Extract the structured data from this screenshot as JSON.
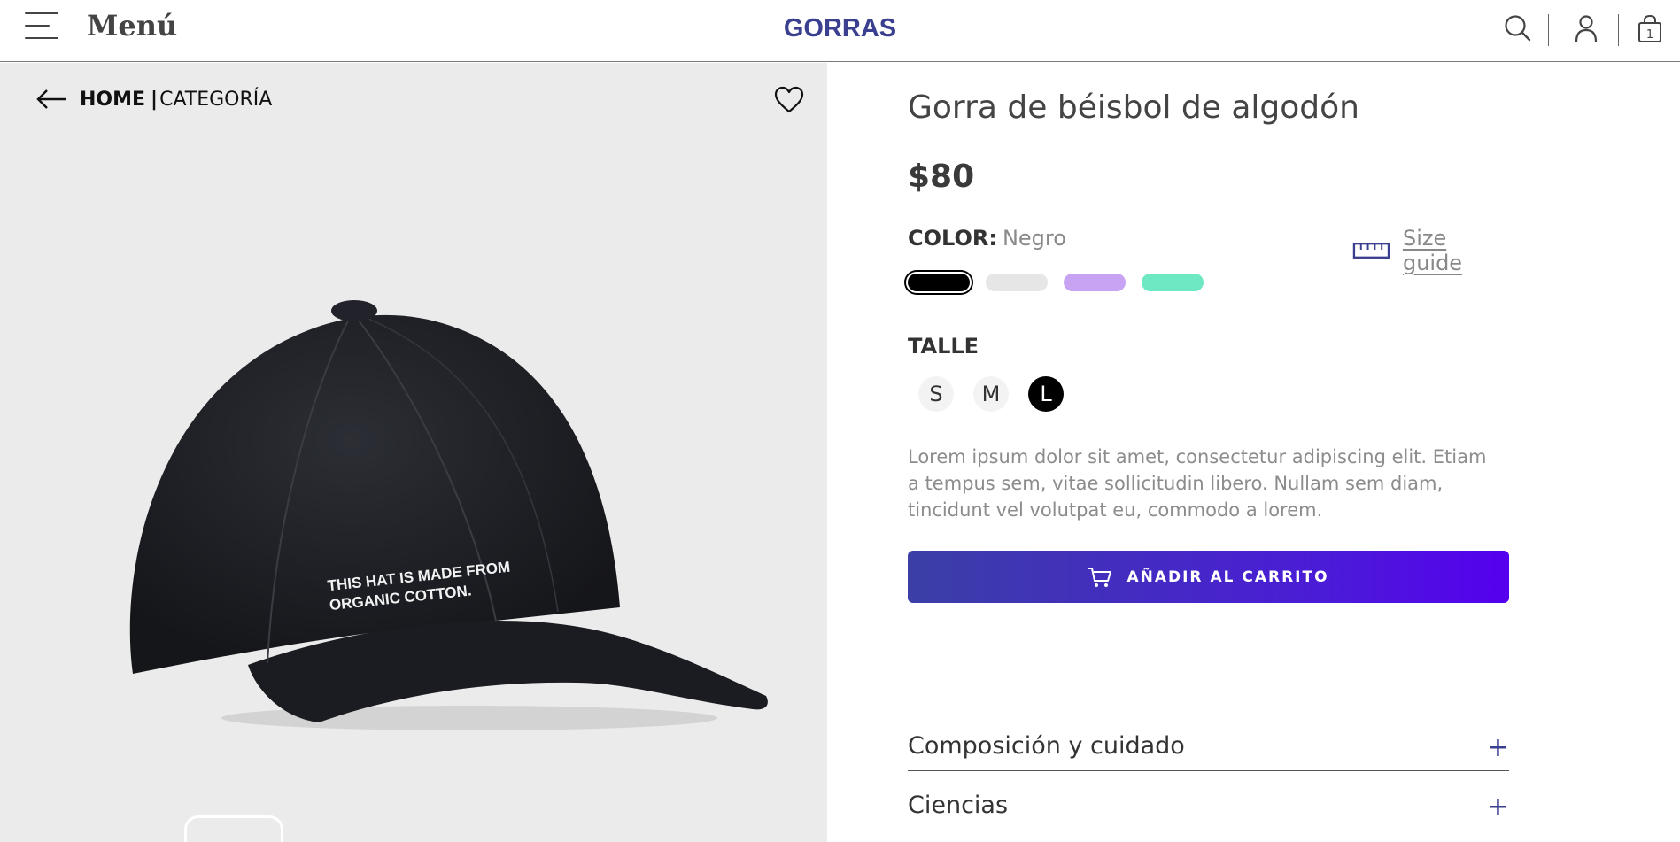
{
  "header": {
    "menu_label": "Menú",
    "brand": "GORRAS",
    "cart_count": "1",
    "icons": [
      "menu-icon",
      "search-icon",
      "user-icon",
      "shopping-bag-icon"
    ]
  },
  "breadcrumb": {
    "home": "HOME",
    "separator": "|",
    "category": "CATEGORÍA"
  },
  "product": {
    "cap_print_line1": "THIS HAT IS MADE FROM",
    "cap_print_line2": "ORGANIC COTTON.",
    "title": "Gorra de béisbol de algodón",
    "price": "$80",
    "color_label": "COLOR:",
    "color_value": "Negro",
    "size_guide": "Size guide",
    "swatches": [
      {
        "name": "Negro",
        "color": "#000000",
        "selected": true
      },
      {
        "name": "Gris",
        "color": "#e6e6e6",
        "selected": false
      },
      {
        "name": "Lila",
        "color": "#c9a3f3",
        "selected": false
      },
      {
        "name": "Verde agua",
        "color": "#6ee8c2",
        "selected": false
      }
    ],
    "size_label": "TALLE",
    "sizes": [
      {
        "label": "S",
        "selected": false
      },
      {
        "label": "M",
        "selected": false
      },
      {
        "label": "L",
        "selected": true
      }
    ],
    "description": "Lorem ipsum dolor sit amet, consectetur adipiscing elit. Etiam a tempus sem, vitae sollicitudin libero. Nullam sem diam, tincidunt vel volutpat eu, commodo a lorem.",
    "add_to_cart": "AÑADIR AL CARRITO",
    "accordions": [
      {
        "title": "Composición y cuidado",
        "icon": "+"
      },
      {
        "title": "Ciencias",
        "icon": "+"
      }
    ]
  },
  "colors": {
    "brand": "#3b3f8f",
    "button_gradient_start": "#3b3fa6",
    "button_gradient_end": "#5500ee",
    "gallery_bg": "#ebebeb"
  }
}
